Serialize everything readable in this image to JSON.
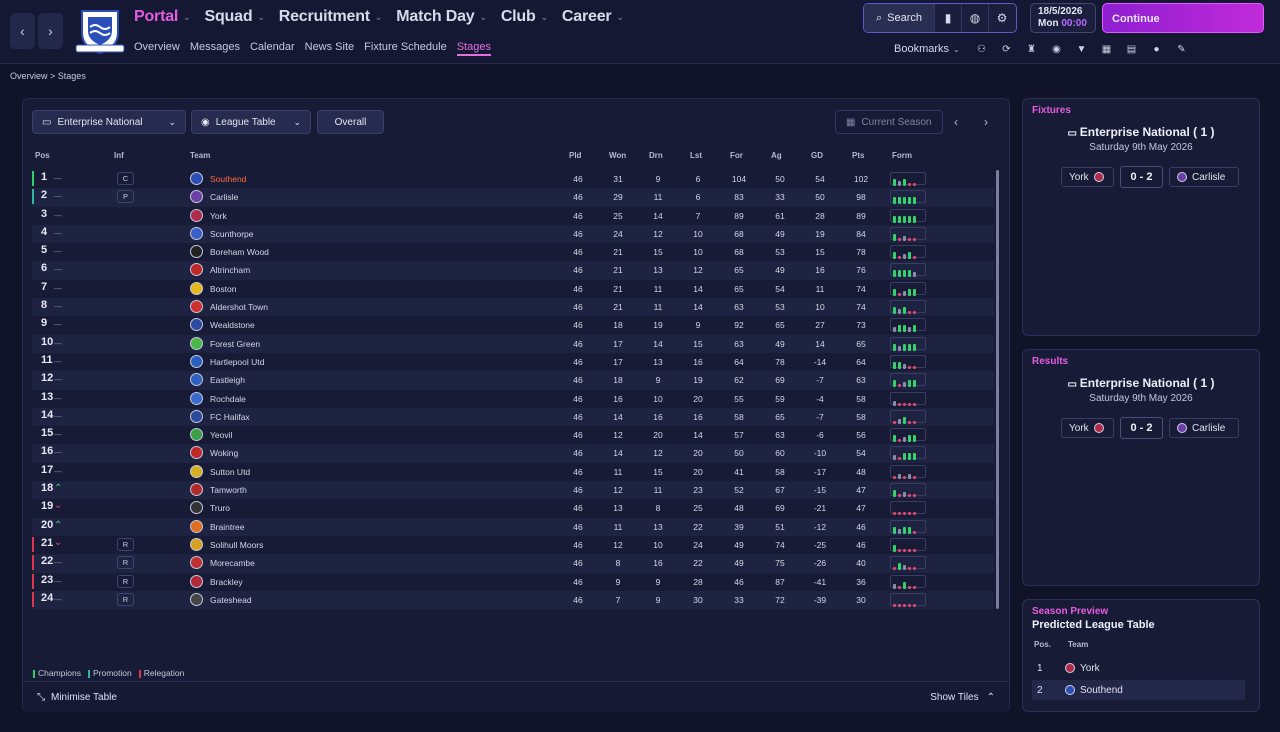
{
  "nav": {
    "items": [
      "Portal",
      "Squad",
      "Recruitment",
      "Match Day",
      "Club",
      "Career"
    ],
    "active": "Portal",
    "sub": [
      "Overview",
      "Messages",
      "Calendar",
      "News Site",
      "Fixture Schedule",
      "Stages"
    ],
    "sub_active": "Stages"
  },
  "topbar": {
    "search_label": "Search",
    "date": "18/5/2026",
    "day": "Mon",
    "time": "00:00",
    "continue_label": "Continue",
    "bookmarks_label": "Bookmarks"
  },
  "breadcrumb": {
    "root": "Overview",
    "current": "Stages"
  },
  "filters": {
    "competition": "Enterprise National",
    "view": "League Table",
    "scope": "Overall",
    "season": "Current Season"
  },
  "table": {
    "headers": {
      "pos": "Pos",
      "inf": "Inf",
      "team": "Team",
      "pld": "Pld",
      "won": "Won",
      "drn": "Drn",
      "lst": "Lst",
      "for": "For",
      "ag": "Ag",
      "gd": "GD",
      "pts": "Pts",
      "form": "Form"
    },
    "rows": [
      {
        "pos": "1",
        "mv": "—",
        "inf": "C",
        "team": "Southend",
        "pld": "46",
        "won": "31",
        "drn": "9",
        "lst": "6",
        "for": "104",
        "ag": "50",
        "gd": "54",
        "pts": "102",
        "form": "WDWLL",
        "zone": "champ",
        "hl": true
      },
      {
        "pos": "2",
        "mv": "—",
        "inf": "P",
        "team": "Carlisle",
        "pld": "46",
        "won": "29",
        "drn": "11",
        "lst": "6",
        "for": "83",
        "ag": "33",
        "gd": "50",
        "pts": "98",
        "form": "WWWWW",
        "zone": "promo"
      },
      {
        "pos": "3",
        "mv": "—",
        "inf": "",
        "team": "York",
        "pld": "46",
        "won": "25",
        "drn": "14",
        "lst": "7",
        "for": "89",
        "ag": "61",
        "gd": "28",
        "pts": "89",
        "form": "WWWWW"
      },
      {
        "pos": "4",
        "mv": "—",
        "inf": "",
        "team": "Scunthorpe",
        "pld": "46",
        "won": "24",
        "drn": "12",
        "lst": "10",
        "for": "68",
        "ag": "49",
        "gd": "19",
        "pts": "84",
        "form": "WLDLL"
      },
      {
        "pos": "5",
        "mv": "—",
        "inf": "",
        "team": "Boreham Wood",
        "pld": "46",
        "won": "21",
        "drn": "15",
        "lst": "10",
        "for": "68",
        "ag": "53",
        "gd": "15",
        "pts": "78",
        "form": "WLDWL"
      },
      {
        "pos": "6",
        "mv": "—",
        "inf": "",
        "team": "Altrincham",
        "pld": "46",
        "won": "21",
        "drn": "13",
        "lst": "12",
        "for": "65",
        "ag": "49",
        "gd": "16",
        "pts": "76",
        "form": "WWWWD"
      },
      {
        "pos": "7",
        "mv": "—",
        "inf": "",
        "team": "Boston",
        "pld": "46",
        "won": "21",
        "drn": "11",
        "lst": "14",
        "for": "65",
        "ag": "54",
        "gd": "11",
        "pts": "74",
        "form": "WLDWW"
      },
      {
        "pos": "8",
        "mv": "—",
        "inf": "",
        "team": "Aldershot Town",
        "pld": "46",
        "won": "21",
        "drn": "11",
        "lst": "14",
        "for": "63",
        "ag": "53",
        "gd": "10",
        "pts": "74",
        "form": "WDWLL"
      },
      {
        "pos": "9",
        "mv": "—",
        "inf": "",
        "team": "Wealdstone",
        "pld": "46",
        "won": "18",
        "drn": "19",
        "lst": "9",
        "for": "92",
        "ag": "65",
        "gd": "27",
        "pts": "73",
        "form": "DWWDW"
      },
      {
        "pos": "10",
        "mv": "—",
        "inf": "",
        "team": "Forest Green",
        "pld": "46",
        "won": "17",
        "drn": "14",
        "lst": "15",
        "for": "63",
        "ag": "49",
        "gd": "14",
        "pts": "65",
        "form": "WDWWW"
      },
      {
        "pos": "11",
        "mv": "—",
        "inf": "",
        "team": "Hartlepool Utd",
        "pld": "46",
        "won": "17",
        "drn": "13",
        "lst": "16",
        "for": "64",
        "ag": "78",
        "gd": "-14",
        "pts": "64",
        "form": "WWDLL"
      },
      {
        "pos": "12",
        "mv": "—",
        "inf": "",
        "team": "Eastleigh",
        "pld": "46",
        "won": "18",
        "drn": "9",
        "lst": "19",
        "for": "62",
        "ag": "69",
        "gd": "-7",
        "pts": "63",
        "form": "WLDWW"
      },
      {
        "pos": "13",
        "mv": "—",
        "inf": "",
        "team": "Rochdale",
        "pld": "46",
        "won": "16",
        "drn": "10",
        "lst": "20",
        "for": "55",
        "ag": "59",
        "gd": "-4",
        "pts": "58",
        "form": "DLLLL"
      },
      {
        "pos": "14",
        "mv": "—",
        "inf": "",
        "team": "FC Halifax",
        "pld": "46",
        "won": "14",
        "drn": "16",
        "lst": "16",
        "for": "58",
        "ag": "65",
        "gd": "-7",
        "pts": "58",
        "form": "LDWLL"
      },
      {
        "pos": "15",
        "mv": "—",
        "inf": "",
        "team": "Yeovil",
        "pld": "46",
        "won": "12",
        "drn": "20",
        "lst": "14",
        "for": "57",
        "ag": "63",
        "gd": "-6",
        "pts": "56",
        "form": "WLDWW"
      },
      {
        "pos": "16",
        "mv": "—",
        "inf": "",
        "team": "Woking",
        "pld": "46",
        "won": "14",
        "drn": "12",
        "lst": "20",
        "for": "50",
        "ag": "60",
        "gd": "-10",
        "pts": "54",
        "form": "DLWWW"
      },
      {
        "pos": "17",
        "mv": "—",
        "inf": "",
        "team": "Sutton Utd",
        "pld": "46",
        "won": "11",
        "drn": "15",
        "lst": "20",
        "for": "41",
        "ag": "58",
        "gd": "-17",
        "pts": "48",
        "form": "LDLDL"
      },
      {
        "pos": "18",
        "mv": "up",
        "inf": "",
        "team": "Tamworth",
        "pld": "46",
        "won": "12",
        "drn": "11",
        "lst": "23",
        "for": "52",
        "ag": "67",
        "gd": "-15",
        "pts": "47",
        "form": "WLDLL"
      },
      {
        "pos": "19",
        "mv": "down",
        "inf": "",
        "team": "Truro",
        "pld": "46",
        "won": "13",
        "drn": "8",
        "lst": "25",
        "for": "48",
        "ag": "69",
        "gd": "-21",
        "pts": "47",
        "form": "LLLLL"
      },
      {
        "pos": "20",
        "mv": "up",
        "inf": "",
        "team": "Braintree",
        "pld": "46",
        "won": "11",
        "drn": "13",
        "lst": "22",
        "for": "39",
        "ag": "51",
        "gd": "-12",
        "pts": "46",
        "form": "WDWWL"
      },
      {
        "pos": "21",
        "mv": "down",
        "inf": "R",
        "team": "Solihull Moors",
        "pld": "46",
        "won": "12",
        "drn": "10",
        "lst": "24",
        "for": "49",
        "ag": "74",
        "gd": "-25",
        "pts": "46",
        "form": "WLLLL",
        "zone": "releg"
      },
      {
        "pos": "22",
        "mv": "—",
        "inf": "R",
        "team": "Morecambe",
        "pld": "46",
        "won": "8",
        "drn": "16",
        "lst": "22",
        "for": "49",
        "ag": "75",
        "gd": "-26",
        "pts": "40",
        "form": "LWDLL",
        "zone": "releg"
      },
      {
        "pos": "23",
        "mv": "—",
        "inf": "R",
        "team": "Brackley",
        "pld": "46",
        "won": "9",
        "drn": "9",
        "lst": "28",
        "for": "46",
        "ag": "87",
        "gd": "-41",
        "pts": "36",
        "form": "DLWLL",
        "zone": "releg"
      },
      {
        "pos": "24",
        "mv": "—",
        "inf": "R",
        "team": "Gateshead",
        "pld": "46",
        "won": "7",
        "drn": "9",
        "lst": "30",
        "for": "33",
        "ag": "72",
        "gd": "-39",
        "pts": "30",
        "form": "LLLLL",
        "zone": "releg"
      }
    ]
  },
  "legend": {
    "champions": "Champions",
    "promotion": "Promotion",
    "relegation": "Relegation"
  },
  "footer": {
    "minimise": "Minimise Table",
    "show_tiles": "Show Tiles"
  },
  "fixtures": {
    "title": "Fixtures",
    "competition": "Enterprise National ( 1 )",
    "date": "Saturday 9th May 2026",
    "home": "York",
    "score": "0 - 2",
    "away": "Carlisle"
  },
  "results": {
    "title": "Results",
    "competition": "Enterprise National ( 1 )",
    "date": "Saturday 9th May 2026",
    "home": "York",
    "score": "0 - 2",
    "away": "Carlisle"
  },
  "preview": {
    "title": "Season Preview",
    "subtitle": "Predicted League Table",
    "col_pos": "Pos.",
    "col_team": "Team",
    "rows": [
      {
        "pos": "1",
        "team": "York"
      },
      {
        "pos": "2",
        "team": "Southend"
      }
    ]
  },
  "colors": {
    "accent": "#e45ce0",
    "win": "#34d36a",
    "draw": "#8a8ea8",
    "loss": "#e0466a",
    "champ": "#2fd06a",
    "promo": "#2fb8a0",
    "releg": "#e0354f",
    "highlight": "#ff6a3d"
  },
  "badge_colors": {
    "Southend": "#2a4fb8",
    "Carlisle": "#6c3fa8",
    "York": "#b02a4a",
    "Scunthorpe": "#3a5fc8",
    "Boreham Wood": "#222",
    "Altrincham": "#c02828",
    "Boston": "#e6b81c",
    "Aldershot Town": "#d03030",
    "Wealdstone": "#2d4aa0",
    "Forest Green": "#4ab848",
    "Hartlepool Utd": "#2a5fc0",
    "Eastleigh": "#3060c0",
    "Rochdale": "#3a6ad0",
    "FC Halifax": "#2a4a9a",
    "Yeovil": "#3aa048",
    "Woking": "#c02828",
    "Sutton Utd": "#d4b020",
    "Tamworth": "#b02a2a",
    "Truro": "#333",
    "Braintree": "#e07020",
    "Solihull Moors": "#d8a020",
    "Morecambe": "#c03030",
    "Brackley": "#b02a3a",
    "Gateshead": "#444"
  }
}
